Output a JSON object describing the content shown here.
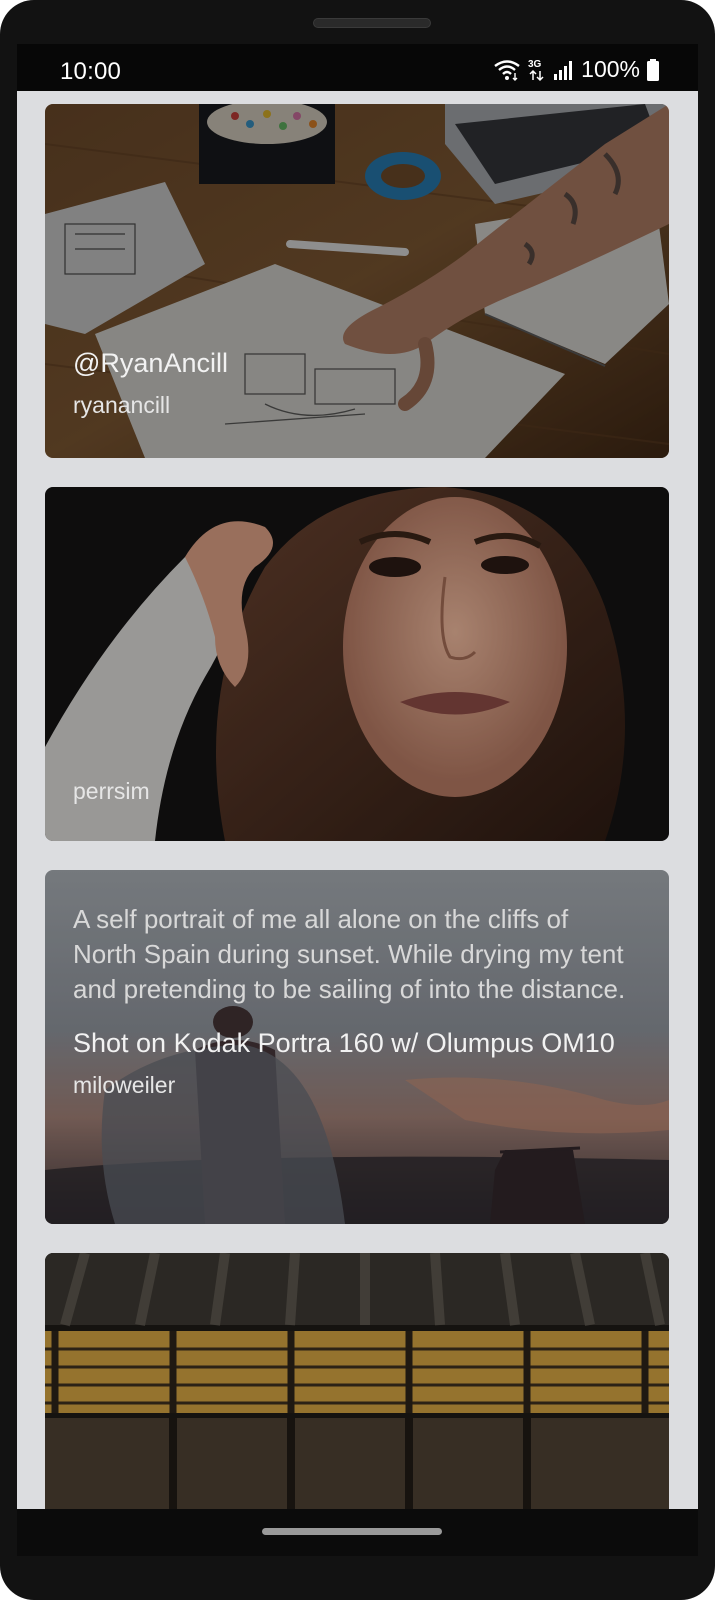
{
  "status_bar": {
    "time": "10:00",
    "network_type": "3G",
    "battery_percent": "100%",
    "icons": [
      "wifi-icon",
      "mobile-data-icon",
      "signal-icon",
      "battery-icon"
    ]
  },
  "feed": {
    "cards": [
      {
        "title": "@RyanAncill",
        "description": "",
        "author": "ryanancill",
        "image": "desk-sketch-photo"
      },
      {
        "title": "",
        "description": "",
        "author": "perrsim",
        "image": "woman-portrait-photo"
      },
      {
        "title": "Shot on Kodak Portra 160 w/ Olumpus OM10",
        "description": "A self portrait of me all alone on the cliffs of North Spain during sunset. While drying my tent and pretending to be sailing of into the distance.",
        "author": "miloweiler",
        "image": "cliff-sunset-photo"
      },
      {
        "title": "",
        "description": "",
        "author": "",
        "image": "lit-building-night-photo"
      }
    ]
  },
  "colors": {
    "screen_background": "#dcdde0",
    "status_bar": "#070707",
    "overlay_text": "#f2f2f2"
  }
}
